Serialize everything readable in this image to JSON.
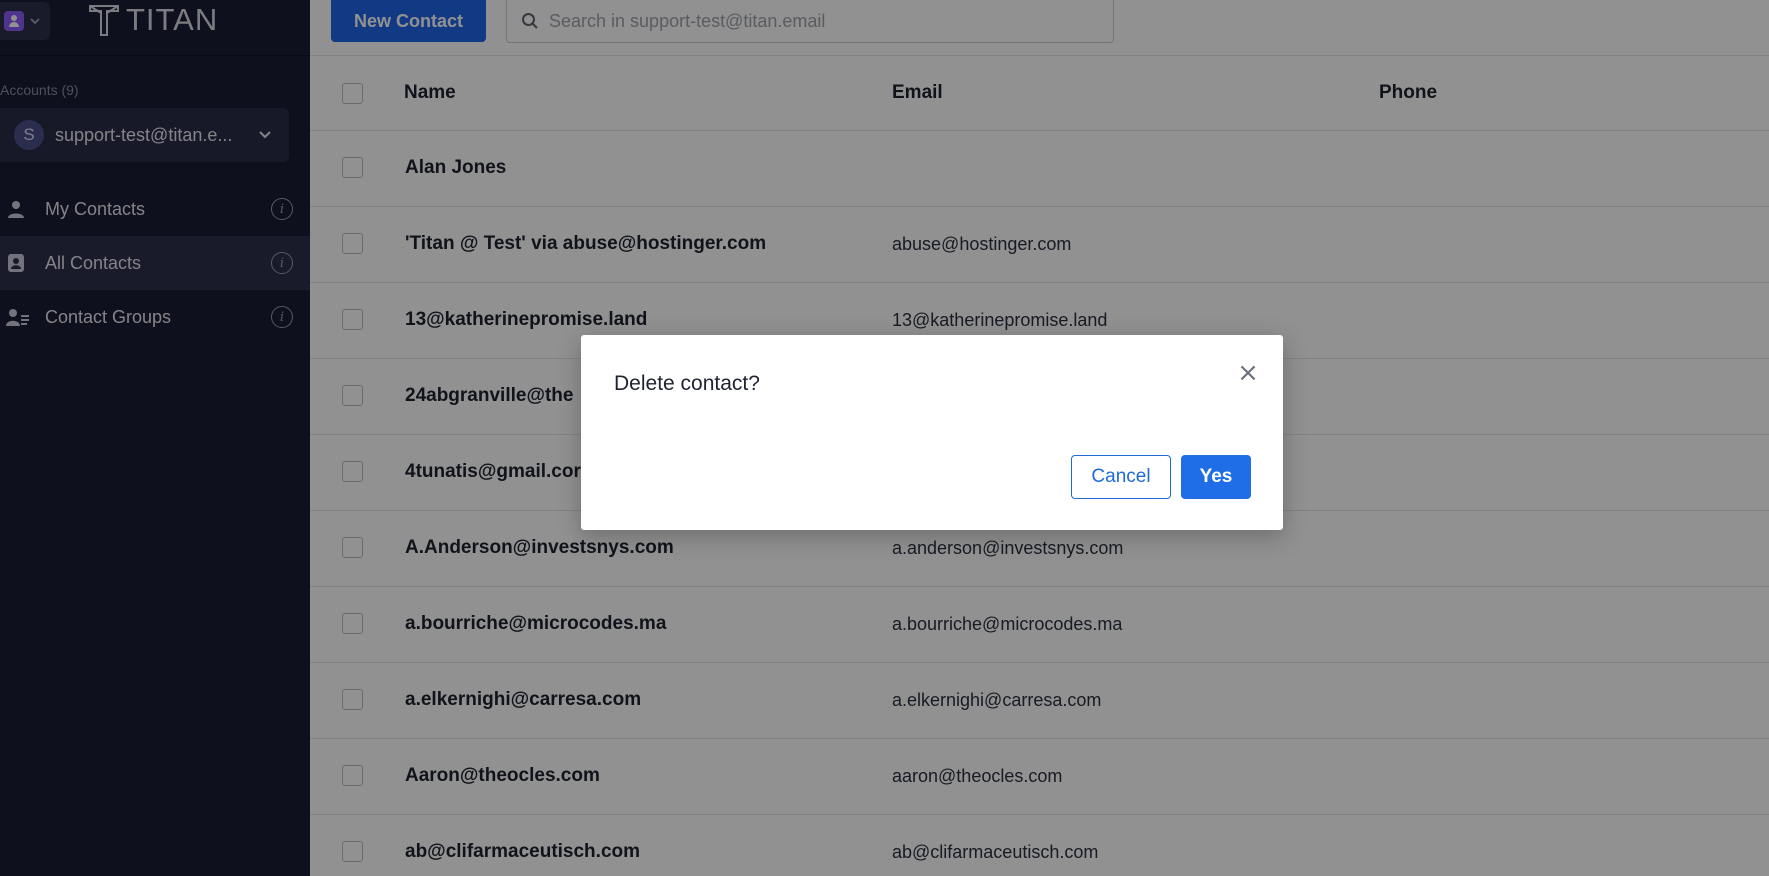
{
  "app": {
    "logo_text": "TITAN"
  },
  "sidebar": {
    "accounts_label": "Accounts (9)",
    "account": {
      "avatar_letter": "S",
      "email": "support-test@titan.e..."
    },
    "items": [
      {
        "label": "My Contacts",
        "icon": "person-icon"
      },
      {
        "label": "All Contacts",
        "icon": "contact-book-icon",
        "active": true
      },
      {
        "label": "Contact Groups",
        "icon": "contact-group-icon"
      }
    ]
  },
  "toolbar": {
    "new_contact_label": "New Contact",
    "search_placeholder": "Search in support-test@titan.email"
  },
  "table": {
    "columns": [
      "Name",
      "Email",
      "Phone"
    ],
    "rows": [
      {
        "name": "Alan Jones",
        "email": "",
        "phone": ""
      },
      {
        "name": "'Titan @ Test' via abuse@hostinger.com",
        "email": "abuse@hostinger.com",
        "phone": ""
      },
      {
        "name": "13@katherinepromise.land",
        "email": "13@katherinepromise.land",
        "phone": ""
      },
      {
        "name": "24abgranville@the",
        "email": "",
        "phone": ""
      },
      {
        "name": "4tunatis@gmail.cor",
        "email": "",
        "phone": ""
      },
      {
        "name": "A.Anderson@investsnys.com",
        "email": "a.anderson@investsnys.com",
        "phone": ""
      },
      {
        "name": "a.bourriche@microcodes.ma",
        "email": "a.bourriche@microcodes.ma",
        "phone": ""
      },
      {
        "name": "a.elkernighi@carresa.com",
        "email": "a.elkernighi@carresa.com",
        "phone": ""
      },
      {
        "name": "Aaron@theocles.com",
        "email": "aaron@theocles.com",
        "phone": ""
      },
      {
        "name": "ab@clifarmaceutisch.com",
        "email": "ab@clifarmaceutisch.com",
        "phone": ""
      }
    ]
  },
  "dialog": {
    "title": "Delete contact?",
    "close_symbol": "×",
    "cancel_label": "Cancel",
    "confirm_label": "Yes"
  },
  "colors": {
    "sidebar_bg": "#1b1d33",
    "primary": "#2166e8",
    "overlay": "rgba(0,0,0,0.43)"
  }
}
